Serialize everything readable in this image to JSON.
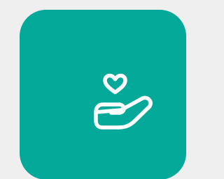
{
  "app_tile": {
    "icon": "hand-heart-icon",
    "background_color": "#05a99a",
    "page_background_color": "#efefef",
    "icon_color": "#ffffff"
  }
}
